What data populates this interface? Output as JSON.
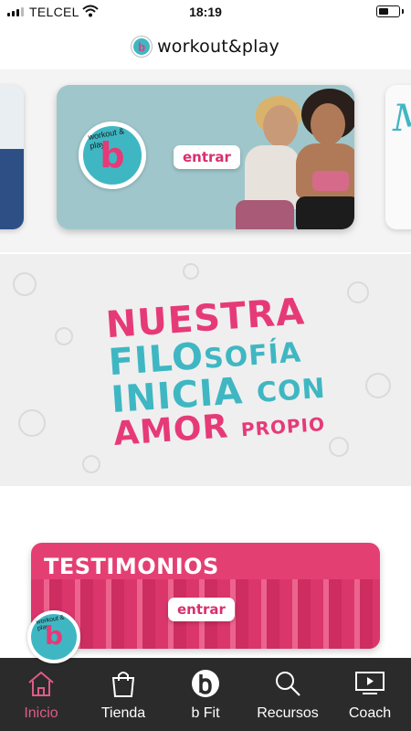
{
  "status_bar": {
    "carrier": "TELCEL",
    "time": "18:19"
  },
  "header": {
    "logo_letter": "b",
    "title": "workout&play"
  },
  "carousel": {
    "main_card": {
      "badge_letter": "b",
      "badge_arc": "workout & play",
      "button_label": "entrar"
    },
    "right_card_letter": "M"
  },
  "philosophy": {
    "line1": "NUESTRA",
    "line2_a": "FILO",
    "line2_b": "SOFÍA",
    "line3_a": "INICIA",
    "line3_b": "CON",
    "line4_a": "AMOR",
    "line4_b": "PROPIO"
  },
  "testimonials": {
    "title": "TESTIMONIOS",
    "button_label": "entrar",
    "badge_letter": "b",
    "badge_arc": "workout & play"
  },
  "tab_bar": {
    "tabs": [
      {
        "label": "Inicio",
        "icon": "home-icon",
        "active": true
      },
      {
        "label": "Tienda",
        "icon": "shopping-bag-icon"
      },
      {
        "label": "b Fit",
        "icon": "b-logo-icon"
      },
      {
        "label": "Recursos",
        "icon": "search-icon"
      },
      {
        "label": "Coach",
        "icon": "tv-play-icon"
      }
    ]
  },
  "colors": {
    "pink": "#e63a78",
    "teal": "#3fb7c3",
    "tab_bg": "#2b2b2b",
    "tab_active": "#e05b86"
  }
}
